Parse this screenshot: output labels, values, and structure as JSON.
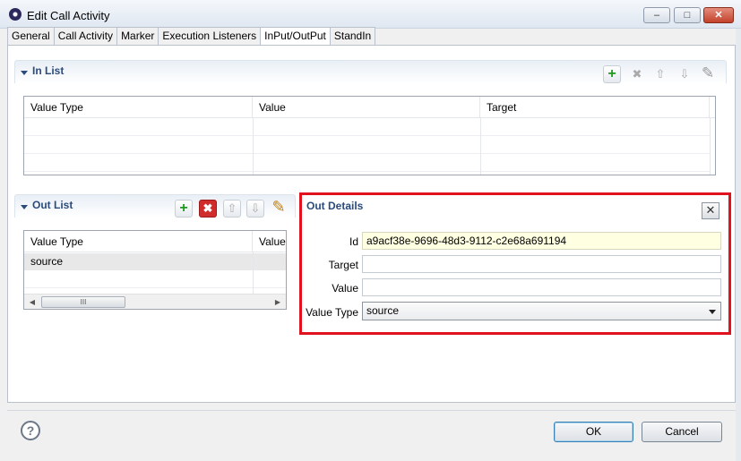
{
  "window": {
    "title": "Edit Call Activity",
    "minimize_glyph": "‒",
    "maximize_glyph": "□",
    "close_glyph": "✕"
  },
  "tabs": [
    {
      "label": "General",
      "active": false
    },
    {
      "label": "Call Activity",
      "active": false
    },
    {
      "label": "Marker",
      "active": false
    },
    {
      "label": "Execution Listeners",
      "active": false
    },
    {
      "label": "InPut/OutPut",
      "active": true
    },
    {
      "label": "StandIn",
      "active": false
    }
  ],
  "in_list": {
    "title": "In List",
    "columns": [
      "Value Type",
      "Value",
      "Target"
    ],
    "rows": []
  },
  "out_list": {
    "title": "Out List",
    "columns": [
      "Value Type",
      "Value"
    ],
    "rows": [
      {
        "value_type": "source",
        "value": ""
      }
    ]
  },
  "out_details": {
    "title": "Out Details",
    "id_label": "Id",
    "id_value": "a9acf38e-9696-48d3-9112-c2e68a691194",
    "target_label": "Target",
    "target_value": "",
    "value_label": "Value",
    "value_value": "",
    "value_type_label": "Value Type",
    "value_type_selected": "source"
  },
  "toolbar_glyphs": {
    "add": "+",
    "remove": "✖",
    "up": "⇧",
    "down": "⇩",
    "edit": "✎",
    "scroll_left": "◀",
    "scroll_right": "▶",
    "scroll_grip": "III",
    "help": "?"
  },
  "footer": {
    "ok_label": "OK",
    "cancel_label": "Cancel"
  },
  "colors": {
    "section_title": "#2a4b7c",
    "highlight_border": "#e0121e",
    "add_icon": "#1d9a1d",
    "remove_active": "#d12c2c"
  }
}
